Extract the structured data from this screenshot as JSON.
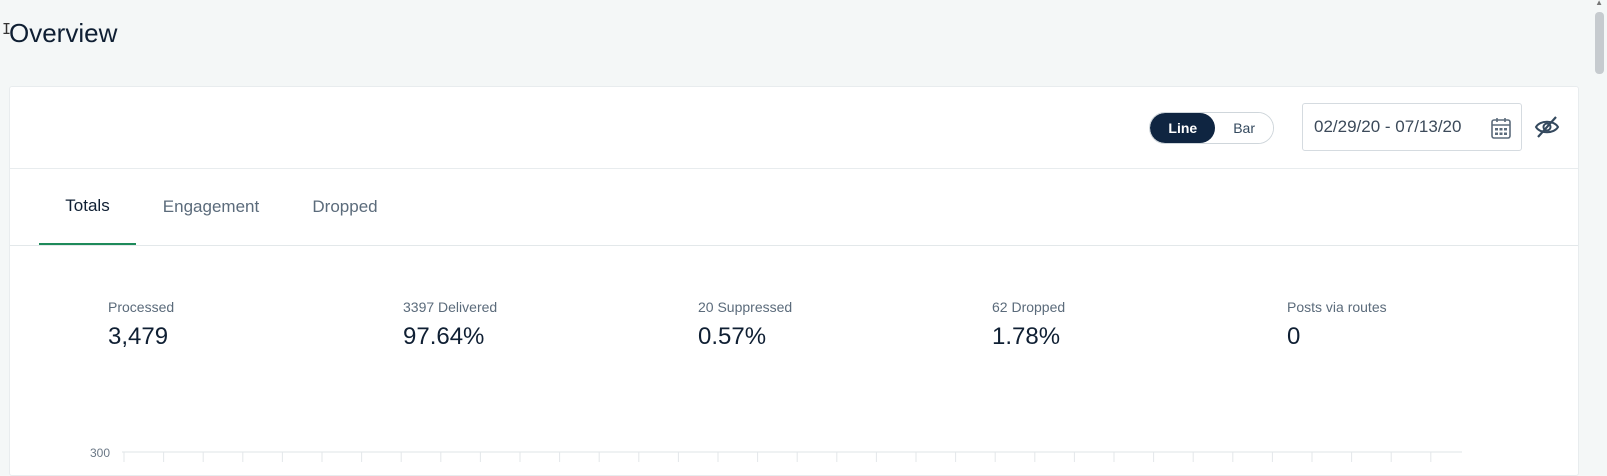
{
  "header": {
    "title": "Overview"
  },
  "toolbar": {
    "toggle": {
      "line_label": "Line",
      "bar_label": "Bar",
      "selected": "Line"
    },
    "date_range": "02/29/20 - 07/13/20",
    "icons": {
      "calendar": "calendar-icon",
      "hide": "eye-off-icon"
    }
  },
  "tabs": [
    {
      "label": "Totals",
      "active": true
    },
    {
      "label": "Engagement",
      "active": false
    },
    {
      "label": "Dropped",
      "active": false
    }
  ],
  "stats": [
    {
      "label": "Processed",
      "value": "3,479"
    },
    {
      "label": "3397 Delivered",
      "value": "97.64%"
    },
    {
      "label": "20 Suppressed",
      "value": "0.57%"
    },
    {
      "label": "62 Dropped",
      "value": "1.78%"
    },
    {
      "label": "Posts via routes",
      "value": "0"
    }
  ],
  "chart": {
    "y_tick_top": "300"
  },
  "colors": {
    "accent_tab": "#1e8a5a",
    "toggle_active": "#0f2541"
  }
}
